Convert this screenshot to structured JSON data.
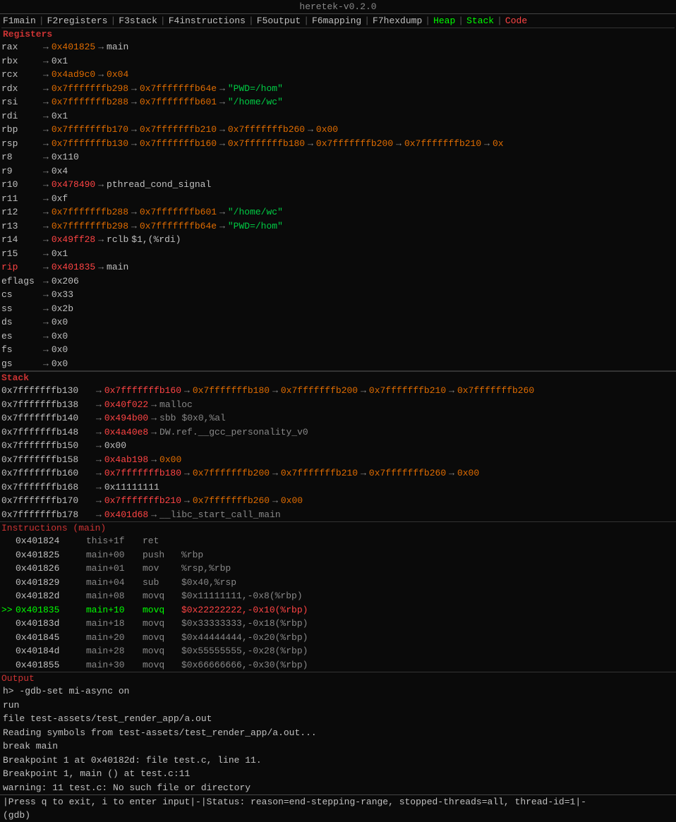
{
  "title": "heretek-v0.2.0",
  "menu": {
    "items": [
      {
        "key": "F1",
        "label": "main",
        "active": false
      },
      {
        "key": "F2",
        "label": "registers",
        "active": false
      },
      {
        "key": "F3",
        "label": "stack",
        "active": false
      },
      {
        "key": "F4",
        "label": "instructions",
        "active": false
      },
      {
        "key": "F5",
        "label": "output",
        "active": false
      },
      {
        "key": "F6",
        "label": "mapping",
        "active": false
      },
      {
        "key": "F7",
        "label": "hexdump",
        "active": false
      },
      {
        "key": "",
        "label": "Heap",
        "active": true,
        "class": "heap"
      },
      {
        "key": "",
        "label": "Stack",
        "active": true,
        "class": "stack-nav"
      },
      {
        "key": "",
        "label": "Code",
        "active": true,
        "class": "code"
      }
    ]
  },
  "registers": {
    "header": "Registers",
    "rows": [
      {
        "name": "rax",
        "val": "0x401825",
        "highlight": false,
        "chain": [
          {
            "val": "main",
            "type": "sym"
          }
        ]
      },
      {
        "name": "rbx",
        "val": "0x1",
        "highlight": false,
        "chain": []
      },
      {
        "name": "rcx",
        "val": "0x4ad9c0",
        "highlight": false,
        "chain": [
          {
            "val": "0x04",
            "type": "ptr"
          }
        ]
      },
      {
        "name": "rdx",
        "val": "0x7fffffffb298",
        "highlight": false,
        "chain": [
          {
            "val": "0x7fffffffb64e",
            "type": "ptr"
          },
          {
            "val": "\"PWD=/hom\"",
            "type": "str"
          }
        ]
      },
      {
        "name": "rsi",
        "val": "0x7fffffffb288",
        "highlight": false,
        "chain": [
          {
            "val": "0x7fffffffb601",
            "type": "ptr"
          },
          {
            "val": "\"/home/wc\"",
            "type": "str"
          }
        ]
      },
      {
        "name": "rdi",
        "val": "0x1",
        "highlight": false,
        "chain": []
      },
      {
        "name": "rbp",
        "val": "0x7fffffffb170",
        "highlight": false,
        "chain": [
          {
            "val": "0x7fffffffb210",
            "type": "ptr"
          },
          {
            "val": "0x7fffffffb260",
            "type": "ptr"
          },
          {
            "val": "0x00",
            "type": "ptr"
          }
        ]
      },
      {
        "name": "rsp",
        "val": "0x7fffffffb130",
        "highlight": false,
        "chain": [
          {
            "val": "0x7fffffffb160",
            "type": "ptr"
          },
          {
            "val": "0x7fffffffb180",
            "type": "ptr"
          },
          {
            "val": "0x7fffffffb200",
            "type": "ptr"
          },
          {
            "val": "0x7fffffffb210",
            "type": "ptr"
          },
          {
            "val": "0x",
            "type": "ptr"
          }
        ]
      },
      {
        "name": "r8",
        "val": "0x110",
        "highlight": false,
        "chain": []
      },
      {
        "name": "r9",
        "val": "0x4",
        "highlight": false,
        "chain": []
      },
      {
        "name": "r10",
        "val": "0x478490",
        "highlight": true,
        "chain": [
          {
            "val": "pthread_cond_signal",
            "type": "sym"
          }
        ]
      },
      {
        "name": "r11",
        "val": "0xf",
        "highlight": false,
        "chain": []
      },
      {
        "name": "r12",
        "val": "0x7fffffffb288",
        "highlight": false,
        "chain": [
          {
            "val": "0x7fffffffb601",
            "type": "ptr"
          },
          {
            "val": "\"/home/wc\"",
            "type": "str"
          }
        ]
      },
      {
        "name": "r13",
        "val": "0x7fffffffb298",
        "highlight": false,
        "chain": [
          {
            "val": "0x7fffffffb64e",
            "type": "ptr"
          },
          {
            "val": "\"PWD=/hom\"",
            "type": "str"
          }
        ]
      },
      {
        "name": "r14",
        "val": "0x49ff28",
        "highlight": true,
        "chain": [
          {
            "val": "rclb",
            "type": "sym"
          },
          {
            "val": "$1,(%rdi)",
            "type": "sym"
          }
        ]
      },
      {
        "name": "r15",
        "val": "0x1",
        "highlight": false,
        "chain": []
      },
      {
        "name": "rip",
        "val": "0x401835",
        "highlight": true,
        "chain": [
          {
            "val": "main",
            "type": "sym"
          }
        ]
      },
      {
        "name": "eflags",
        "val": "0x206",
        "highlight": false,
        "chain": []
      },
      {
        "name": "cs",
        "val": "0x33",
        "highlight": false,
        "chain": []
      },
      {
        "name": "ss",
        "val": "0x2b",
        "highlight": false,
        "chain": []
      },
      {
        "name": "ds",
        "val": "0x0",
        "highlight": false,
        "chain": []
      },
      {
        "name": "es",
        "val": "0x0",
        "highlight": false,
        "chain": []
      },
      {
        "name": "fs",
        "val": "0x0",
        "highlight": false,
        "chain": []
      },
      {
        "name": "gs",
        "val": "0x0",
        "highlight": false,
        "chain": []
      }
    ]
  },
  "stack": {
    "header": "Stack",
    "rows": [
      {
        "addr": "0x7fffffffb130",
        "val": "0x7fffffffb160",
        "chain": [
          {
            "val": "0x7fffffffb180",
            "type": "ptr"
          },
          {
            "val": "0x7fffffffb200",
            "type": "ptr"
          },
          {
            "val": "0x7fffffffb210",
            "type": "ptr"
          },
          {
            "val": "0x7fffffffb260",
            "type": "ptr"
          }
        ]
      },
      {
        "addr": "0x7fffffffb138",
        "val": "0x40f022",
        "chain": [
          {
            "val": "malloc",
            "type": "sym"
          }
        ]
      },
      {
        "addr": "0x7fffffffb140",
        "val": "0x494b00",
        "chain": [
          {
            "val": "sbb",
            "type": "sym"
          },
          {
            "val": "$0x0,%al",
            "type": "sym"
          }
        ]
      },
      {
        "addr": "0x7fffffffb148",
        "val": "0x4a40e8",
        "chain": [
          {
            "val": "DW.ref.__gcc_personality_v0",
            "type": "sym"
          }
        ]
      },
      {
        "addr": "0x7fffffffb150",
        "val": "0x00",
        "chain": []
      },
      {
        "addr": "0x7fffffffb158",
        "val": "0x4ab198",
        "chain": [
          {
            "val": "0x00",
            "type": "ptr"
          }
        ]
      },
      {
        "addr": "0x7fffffffb160",
        "val": "0x7fffffffb180",
        "chain": [
          {
            "val": "0x7fffffffb200",
            "type": "ptr"
          },
          {
            "val": "0x7fffffffb210",
            "type": "ptr"
          },
          {
            "val": "0x7fffffffb260",
            "type": "ptr"
          },
          {
            "val": "0x00",
            "type": "ptr"
          }
        ]
      },
      {
        "addr": "0x7fffffffb168",
        "val": "0x11111111",
        "chain": []
      },
      {
        "addr": "0x7fffffffb170",
        "val": "0x7fffffffb210",
        "chain": [
          {
            "val": "0x7fffffffb260",
            "type": "ptr"
          },
          {
            "val": "0x00",
            "type": "ptr"
          }
        ]
      },
      {
        "addr": "0x7fffffffb178",
        "val": "0x401d68",
        "chain": [
          {
            "val": "__libc_start_call_main",
            "type": "sym"
          }
        ]
      }
    ]
  },
  "instructions": {
    "header": "Instructions (main)",
    "rows": [
      {
        "prefix": "",
        "addr": "0x401824",
        "offset": "this+1f",
        "mnemonic": "ret",
        "operands": "",
        "current": false
      },
      {
        "prefix": "",
        "addr": "0x401825",
        "offset": "main+00",
        "mnemonic": "push",
        "operands": "%rbp",
        "current": false
      },
      {
        "prefix": "",
        "addr": "0x401826",
        "offset": "main+01",
        "mnemonic": "mov",
        "operands": "%rsp,%rbp",
        "current": false
      },
      {
        "prefix": "",
        "addr": "0x401829",
        "offset": "main+04",
        "mnemonic": "sub",
        "operands": "$0x40,%rsp",
        "current": false
      },
      {
        "prefix": "",
        "addr": "0x40182d",
        "offset": "main+08",
        "mnemonic": "movq",
        "operands": "$0x11111111,-0x8(%rbp)",
        "current": false
      },
      {
        "prefix": ">>",
        "addr": "0x401835",
        "offset": "main+10",
        "mnemonic": "movq",
        "operands": "$0x22222222,-0x10(%rbp)",
        "current": true
      },
      {
        "prefix": "",
        "addr": "0x40183d",
        "offset": "main+18",
        "mnemonic": "movq",
        "operands": "$0x33333333,-0x18(%rbp)",
        "current": false
      },
      {
        "prefix": "",
        "addr": "0x401845",
        "offset": "main+20",
        "mnemonic": "movq",
        "operands": "$0x44444444,-0x20(%rbp)",
        "current": false
      },
      {
        "prefix": "",
        "addr": "0x40184d",
        "offset": "main+28",
        "mnemonic": "movq",
        "operands": "$0x55555555,-0x28(%rbp)",
        "current": false
      },
      {
        "prefix": "",
        "addr": "0x401855",
        "offset": "main+30",
        "mnemonic": "movq",
        "operands": "$0x66666666,-0x30(%rbp)",
        "current": false
      }
    ]
  },
  "output": {
    "header": "Output",
    "lines": [
      "h> -gdb-set mi-async on",
      "run",
      "file test-assets/test_render_app/a.out",
      "Reading symbols from test-assets/test_render_app/a.out...",
      "break main",
      "Breakpoint 1 at 0x40182d: file test.c, line 11.",
      "Breakpoint 1, main () at test.c:11",
      "warning: 11    test.c: No such file or directory"
    ]
  },
  "statusbar": {
    "press_hint": "|Press q to exit, i to enter input|",
    "status": "-|Status: reason=end-stepping-range, stopped-threads=all, thread-id=1|-",
    "prompt": "(gdb)"
  }
}
